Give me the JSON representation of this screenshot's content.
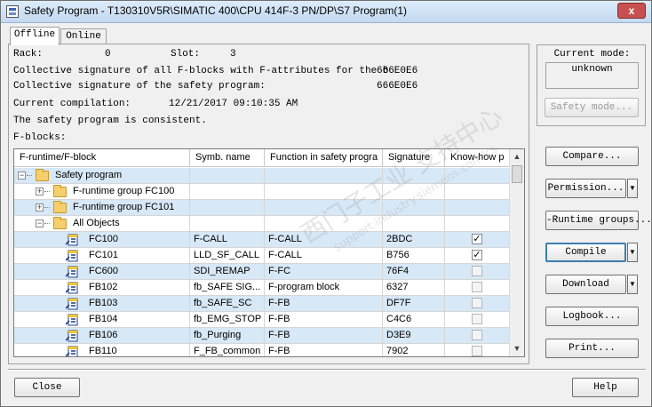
{
  "window": {
    "title": "Safety Program - T130310V5R\\SIMATIC 400\\CPU 414F-3 PN/DP\\S7 Program(1)",
    "close_glyph": "x"
  },
  "tabs": [
    {
      "label": "Offline",
      "active": true
    },
    {
      "label": "Online",
      "active": false
    }
  ],
  "info": {
    "rack_label": "Rack:",
    "rack_value": "0",
    "slot_label": "Slot:",
    "slot_value": "3",
    "collective_fblocks_label": "Collective signature of all F-blocks with F-attributes for the b",
    "collective_fblocks_value": "666E0E6",
    "collective_program_label": "Collective signature of the safety program:",
    "collective_program_value": "666E0E6",
    "compilation_label": "Current compilation:",
    "compilation_value": "12/21/2017 09:10:35 AM",
    "consistency_text": "The safety program is consistent.",
    "fblocks_label": "F-blocks:"
  },
  "table": {
    "columns": [
      "F-runtime/F-block",
      "Symb. name",
      "Function in safety progra",
      "Signature",
      "Know-how p"
    ],
    "rows": [
      {
        "level": 0,
        "kind": "folder",
        "expander": "−",
        "name": "Safety program",
        "symbol": "",
        "function": "",
        "signature": "",
        "knowhow": null
      },
      {
        "level": 1,
        "kind": "folder",
        "expander": "+",
        "name": "F-runtime group FC100",
        "symbol": "",
        "function": "",
        "signature": "",
        "knowhow": null
      },
      {
        "level": 1,
        "kind": "folder",
        "expander": "+",
        "name": "F-runtime group FC101",
        "symbol": "",
        "function": "",
        "signature": "",
        "knowhow": null
      },
      {
        "level": 1,
        "kind": "folder",
        "expander": "−",
        "name": "All Objects",
        "symbol": "",
        "function": "",
        "signature": "",
        "knowhow": null
      },
      {
        "level": 2,
        "kind": "block",
        "name": "FC100",
        "symbol": "F-CALL",
        "function": "F-CALL",
        "signature": "2BDC",
        "knowhow": true
      },
      {
        "level": 2,
        "kind": "block",
        "name": "FC101",
        "symbol": "LLD_SF_CALL",
        "function": "F-CALL",
        "signature": "B756",
        "knowhow": true
      },
      {
        "level": 2,
        "kind": "block",
        "name": "FC600",
        "symbol": "SDI_REMAP",
        "function": "F-FC",
        "signature": "76F4",
        "knowhow": false
      },
      {
        "level": 2,
        "kind": "block",
        "name": "FB102",
        "symbol": "fb_SAFE SIG...",
        "function": "F-program block",
        "signature": "6327",
        "knowhow": false
      },
      {
        "level": 2,
        "kind": "block",
        "name": "FB103",
        "symbol": "fb_SAFE_SC",
        "function": "F-FB",
        "signature": "DF7F",
        "knowhow": false
      },
      {
        "level": 2,
        "kind": "block",
        "name": "FB104",
        "symbol": "fb_EMG_STOP",
        "function": "F-FB",
        "signature": "C4C6",
        "knowhow": false
      },
      {
        "level": 2,
        "kind": "block",
        "name": "FB106",
        "symbol": "fb_Purging",
        "function": "F-FB",
        "signature": "D3E9",
        "knowhow": false
      },
      {
        "level": 2,
        "kind": "block",
        "name": "FB110",
        "symbol": "F_FB_common",
        "function": "F-FB",
        "signature": "7902",
        "knowhow": false
      }
    ],
    "checkmark_glyph": "✓"
  },
  "side": {
    "current_mode_label": "Current mode:",
    "current_mode_value": "unknown",
    "safety_mode_button": "Safety mode...",
    "compare_button": "Compare...",
    "permission_button": "Permission...",
    "runtime_groups_button": "-Runtime groups...",
    "compile_button": "Compile",
    "download_button": "Download",
    "logbook_button": "Logbook...",
    "print_button": "Print..."
  },
  "footer": {
    "close_button": "Close",
    "help_button": "Help"
  },
  "watermark": {
    "main": "西门子工业 支持中心",
    "sub": "support.industry.siemens.com/cs"
  },
  "colors": {
    "title_bar": "#c4d9f0",
    "row_highlight": "#d7e8f7",
    "close_button": "#c75050"
  }
}
